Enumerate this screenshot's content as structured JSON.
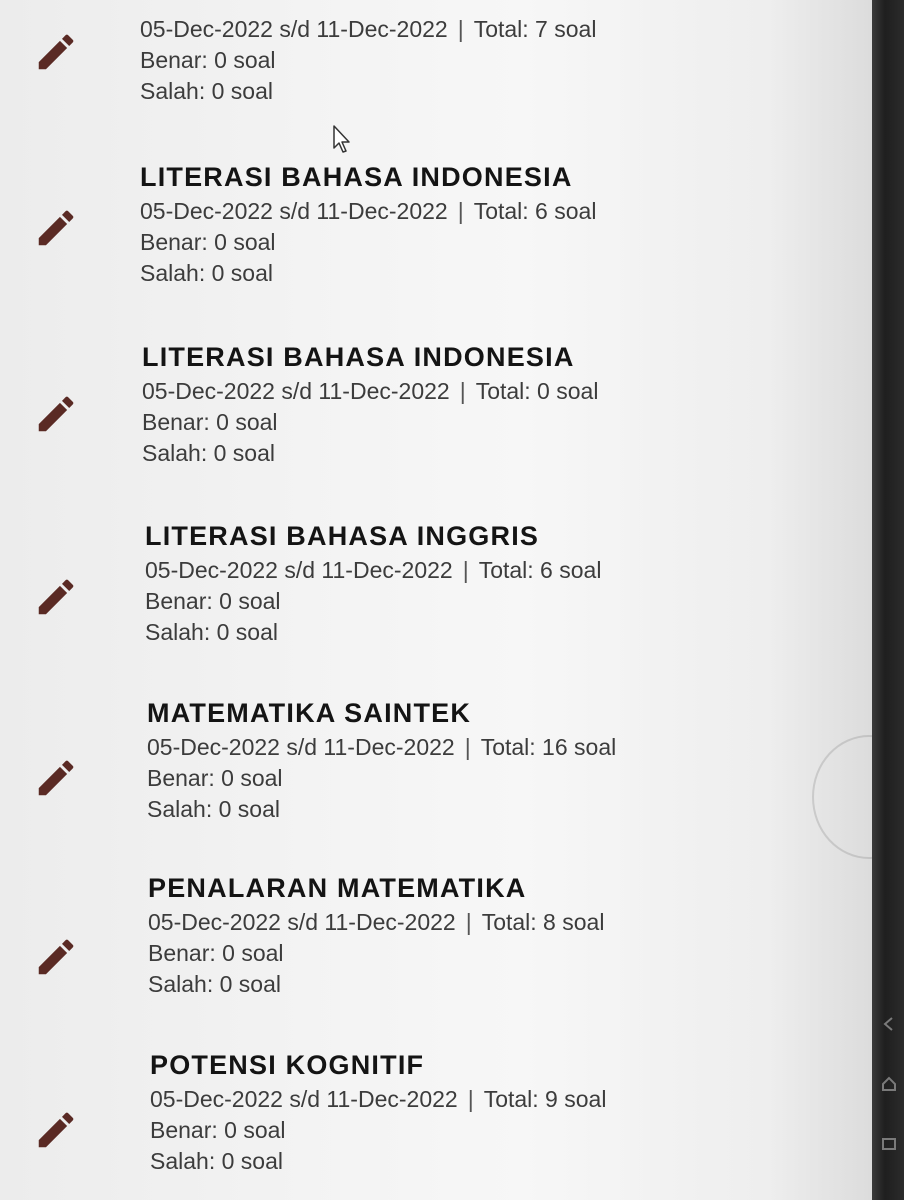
{
  "exams": [
    {
      "title": "",
      "period": "05-Dec-2022 s/d 11-Dec-2022",
      "total": "Total: 7 soal",
      "benar": "Benar: 0 soal",
      "salah": "Salah: 0 soal"
    },
    {
      "title": "LITERASI BAHASA INDONESIA",
      "period": "05-Dec-2022 s/d 11-Dec-2022",
      "total": "Total: 6 soal",
      "benar": "Benar: 0 soal",
      "salah": "Salah: 0 soal"
    },
    {
      "title": "LITERASI BAHASA INDONESIA",
      "period": "05-Dec-2022 s/d 11-Dec-2022",
      "total": "Total: 0 soal",
      "benar": "Benar: 0 soal",
      "salah": "Salah: 0 soal"
    },
    {
      "title": "LITERASI BAHASA INGGRIS",
      "period": "05-Dec-2022 s/d 11-Dec-2022",
      "total": "Total: 6 soal",
      "benar": "Benar: 0 soal",
      "salah": "Salah: 0 soal"
    },
    {
      "title": "MATEMATIKA SAINTEK",
      "period": "05-Dec-2022 s/d 11-Dec-2022",
      "total": "Total: 16 soal",
      "benar": "Benar: 0 soal",
      "salah": "Salah: 0 soal"
    },
    {
      "title": "PENALARAN MATEMATIKA",
      "period": "05-Dec-2022 s/d 11-Dec-2022",
      "total": "Total: 8 soal",
      "benar": "Benar: 0 soal",
      "salah": "Salah: 0 soal"
    },
    {
      "title": "POTENSI KOGNITIF",
      "period": "05-Dec-2022 s/d 11-Dec-2022",
      "total": "Total: 9 soal",
      "benar": "Benar: 0 soal",
      "salah": "Salah: 0 soal"
    }
  ],
  "separator": "|",
  "icons": {
    "edit": "pencil-icon",
    "nav": [
      "back-icon",
      "home-icon",
      "recent-apps-icon"
    ]
  },
  "colors": {
    "pencil": "#5a2a24",
    "title": "#141414",
    "text": "#3c3c3c"
  }
}
